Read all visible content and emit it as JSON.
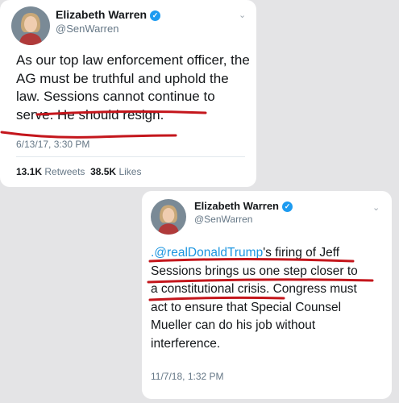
{
  "tweets": [
    {
      "name": "Elizabeth Warren",
      "handle": "@SenWarren",
      "lines": [
        "As our top law enforcement officer, the",
        "AG must be truthful and uphold the",
        "law. Sessions cannot continue to",
        "serve. He should resign."
      ],
      "timestamp": "6/13/17, 3:30 PM",
      "retweets": "13.1K",
      "retweets_label": "Retweets",
      "likes": "38.5K",
      "likes_label": "Likes"
    },
    {
      "name": "Elizabeth Warren",
      "handle": "@SenWarren",
      "mention": ".@realDonaldTrump",
      "lines": [
        "'s firing of Jeff",
        "Sessions brings us one step closer to",
        "a constitutional crisis. Congress must",
        "act to ensure that Special Counsel",
        "Mueller can do his job without",
        "interference."
      ],
      "timestamp": "11/7/18, 1:32 PM"
    }
  ],
  "colors": {
    "link": "#1b95e0",
    "underline": "#c4161c",
    "verified": "#1d9bf0"
  },
  "icons": [
    "verified-badge-icon",
    "chevron-down-icon",
    "avatar"
  ]
}
